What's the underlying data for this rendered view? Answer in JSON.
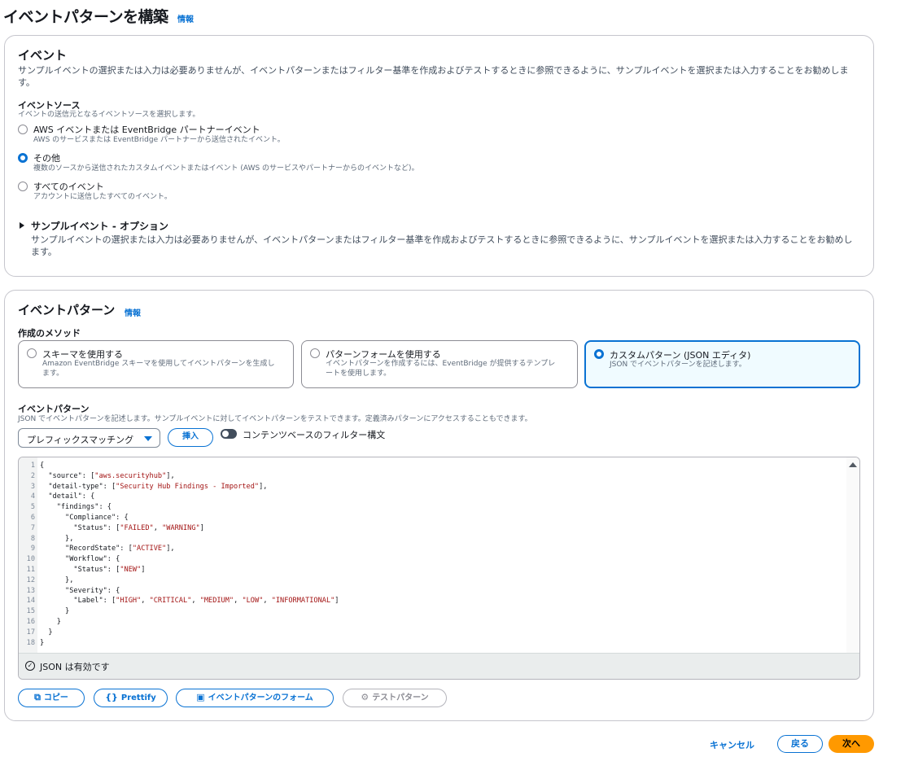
{
  "page": {
    "title": "イベントパターンを構築",
    "info": "情報"
  },
  "event_panel": {
    "title": "イベント",
    "description": "サンプルイベントの選択または入力は必要ありませんが、イベントパターンまたはフィルター基準を作成およびテストするときに参照できるように、サンプルイベントを選択または入力することをお勧めします。",
    "source_label": "イベントソース",
    "source_hint": "イベントの送信元となるイベントソースを選択します。",
    "options": [
      {
        "title": "AWS イベントまたは EventBridge パートナーイベント",
        "desc": "AWS のサービスまたは EventBridge パートナーから送信されたイベント。",
        "selected": false
      },
      {
        "title": "その他",
        "desc": "複数のソースから送信されたカスタムイベントまたはイベント (AWS のサービスやパートナーからのイベントなど)。",
        "selected": true
      },
      {
        "title": "すべてのイベント",
        "desc": "アカウントに送信したすべてのイベント。",
        "selected": false
      }
    ],
    "sample_title": "サンプルイベント - オプション",
    "sample_desc": "サンプルイベントの選択または入力は必要ありませんが、イベントパターンまたはフィルター基準を作成およびテストするときに参照できるように、サンプルイベントを選択または入力することをお勧めします。"
  },
  "pattern_panel": {
    "title": "イベントパターン",
    "info": "情報",
    "method_label": "作成のメソッド",
    "methods": [
      {
        "title": "スキーマを使用する",
        "desc": "Amazon EventBridge スキーマを使用してイベントパターンを生成します。",
        "selected": false
      },
      {
        "title": "パターンフォームを使用する",
        "desc": "イベントパターンを作成するには、EventBridge が提供するテンプレートを使用します。",
        "selected": false
      },
      {
        "title": "カスタムパターン (JSON エディタ)",
        "desc": "JSON でイベントパターンを記述します。",
        "selected": true
      }
    ],
    "pattern_label": "イベントパターン",
    "pattern_hint": "JSON でイベントパターンを記述します。サンプルイベントに対してイベントパターンをテストできます。定義済みパターンにアクセスすることもできます。",
    "select_value": "プレフィックスマッチング",
    "insert_button": "挿入",
    "toggle_label": "コンテンツベースのフィルター構文",
    "code_lines": [
      "{",
      "  \"source\": [\"aws.securityhub\"],",
      "  \"detail-type\": [\"Security Hub Findings - Imported\"],",
      "  \"detail\": {",
      "    \"findings\": {",
      "      \"Compliance\": {",
      "        \"Status\": [\"FAILED\", \"WARNING\"]",
      "      },",
      "      \"RecordState\": [\"ACTIVE\"],",
      "      \"Workflow\": {",
      "        \"Status\": [\"NEW\"]",
      "      },",
      "      \"Severity\": {",
      "        \"Label\": [\"HIGH\", \"CRITICAL\", \"MEDIUM\", \"LOW\", \"INFORMATIONAL\"]",
      "      }",
      "    }",
      "  }",
      "}"
    ],
    "status_text": "JSON は有効です",
    "buttons": {
      "copy": "コピー",
      "prettify": "Prettify",
      "form": "イベントパターンのフォーム",
      "test": "テストパターン"
    }
  },
  "footer": {
    "cancel": "キャンセル",
    "back": "戻る",
    "next": "次へ"
  },
  "colors": {
    "accent": "#0972d3",
    "primary_button": "#ff9900",
    "json_string": "#a31515"
  }
}
